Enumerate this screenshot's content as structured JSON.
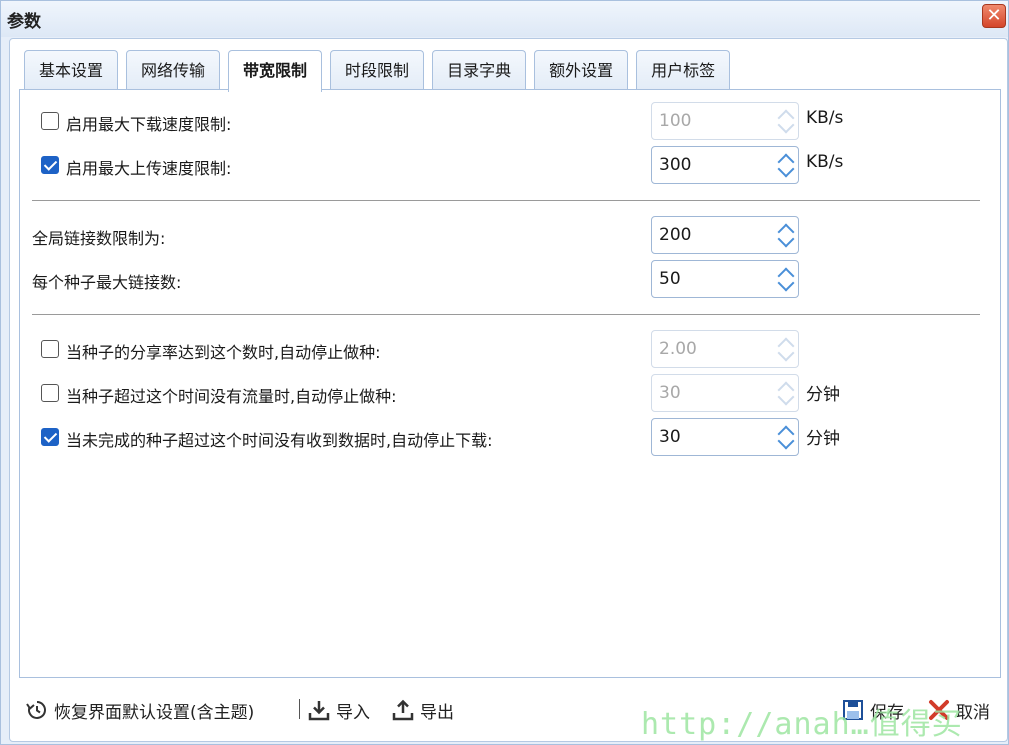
{
  "window": {
    "title": "参数",
    "close_symbol": "✕"
  },
  "tabs": [
    {
      "label": "基本设置",
      "active": false
    },
    {
      "label": "网络传输",
      "active": false
    },
    {
      "label": "带宽限制",
      "active": true
    },
    {
      "label": "时段限制",
      "active": false
    },
    {
      "label": "目录字典",
      "active": false
    },
    {
      "label": "额外设置",
      "active": false
    },
    {
      "label": "用户标签",
      "active": false
    }
  ],
  "bandwidth": {
    "download": {
      "label": "启用最大下载速度限制:",
      "checked": false,
      "value": "100",
      "unit": "KB/s"
    },
    "upload": {
      "label": "启用最大上传速度限制:",
      "checked": true,
      "value": "300",
      "unit": "KB/s"
    }
  },
  "connections": {
    "global": {
      "label": "全局链接数限制为:",
      "value": "200"
    },
    "per_torrent": {
      "label": "每个种子最大链接数:",
      "value": "50"
    }
  },
  "auto_stop": {
    "ratio": {
      "label": "当种子的分享率达到这个数时,自动停止做种:",
      "checked": false,
      "value": "2.00"
    },
    "idle_seed": {
      "label": "当种子超过这个时间没有流量时,自动停止做种:",
      "checked": false,
      "value": "30",
      "unit": "分钟"
    },
    "idle_download": {
      "label": "当未完成的种子超过这个时间没有收到数据时,自动停止下载:",
      "checked": true,
      "value": "30",
      "unit": "分钟"
    }
  },
  "footer": {
    "reset": "恢复界面默认设置(含主题)",
    "import": "导入",
    "export": "导出",
    "save": "保存",
    "cancel": "取消"
  },
  "watermark": "http://anah…值得买",
  "colors": {
    "accent": "#1d62c6",
    "arrow": "#4a8fd8",
    "close": "#d4452a"
  }
}
